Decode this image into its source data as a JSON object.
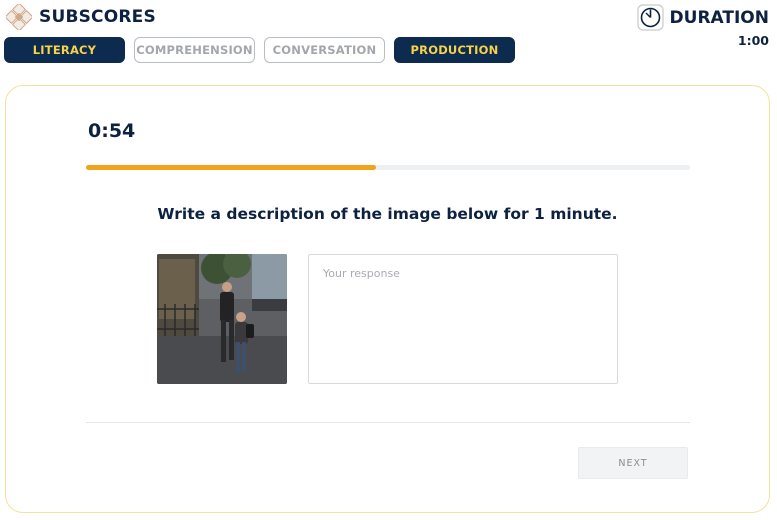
{
  "header": {
    "brand": "SUBSCORES",
    "duration_title": "DURATION",
    "duration_value": "1:00"
  },
  "subscores": [
    {
      "label": "LITERACY",
      "active": true
    },
    {
      "label": "COMPREHENSION",
      "active": false
    },
    {
      "label": "CONVERSATION",
      "active": false
    },
    {
      "label": "PRODUCTION",
      "active": true
    }
  ],
  "question": {
    "timer": "0:54",
    "progress_percent": 48,
    "prompt": "Write a description of the image below for 1 minute.",
    "response_placeholder": "Your response",
    "response_value": "",
    "next_label": "NEXT"
  },
  "colors": {
    "navy": "#0d2a4f",
    "pill_active_text": "#f7d24a",
    "progress": "#f2a31c",
    "card_border": "#f3e29a"
  }
}
